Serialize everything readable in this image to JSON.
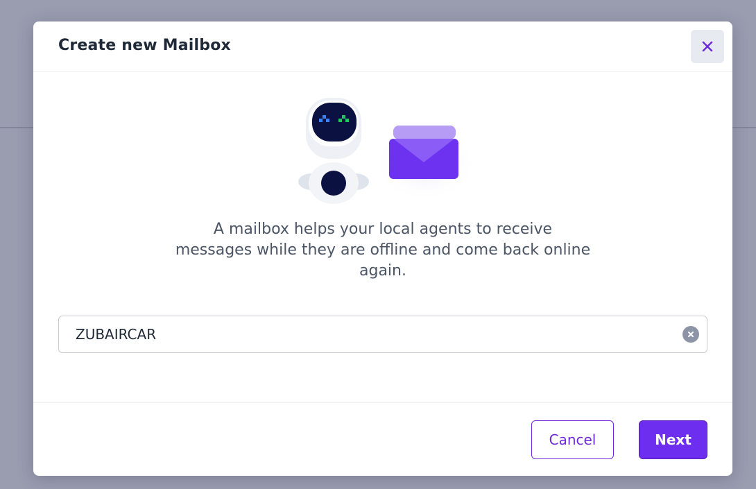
{
  "dialog": {
    "title": "Create new Mailbox",
    "close_icon": "close-icon",
    "description": "A mailbox helps your local agents to receive messages while they are offline and come back online again.",
    "illustration": [
      "robot-illustration",
      "envelope-icon"
    ]
  },
  "mailbox_input": {
    "value": "ZUBAIRCAR",
    "clear_icon": "clear-circle-icon"
  },
  "footer": {
    "cancel_label": "Cancel",
    "next_label": "Next"
  },
  "colors": {
    "accent": "#6d2ef0",
    "backdrop": "#9a9cb0"
  }
}
